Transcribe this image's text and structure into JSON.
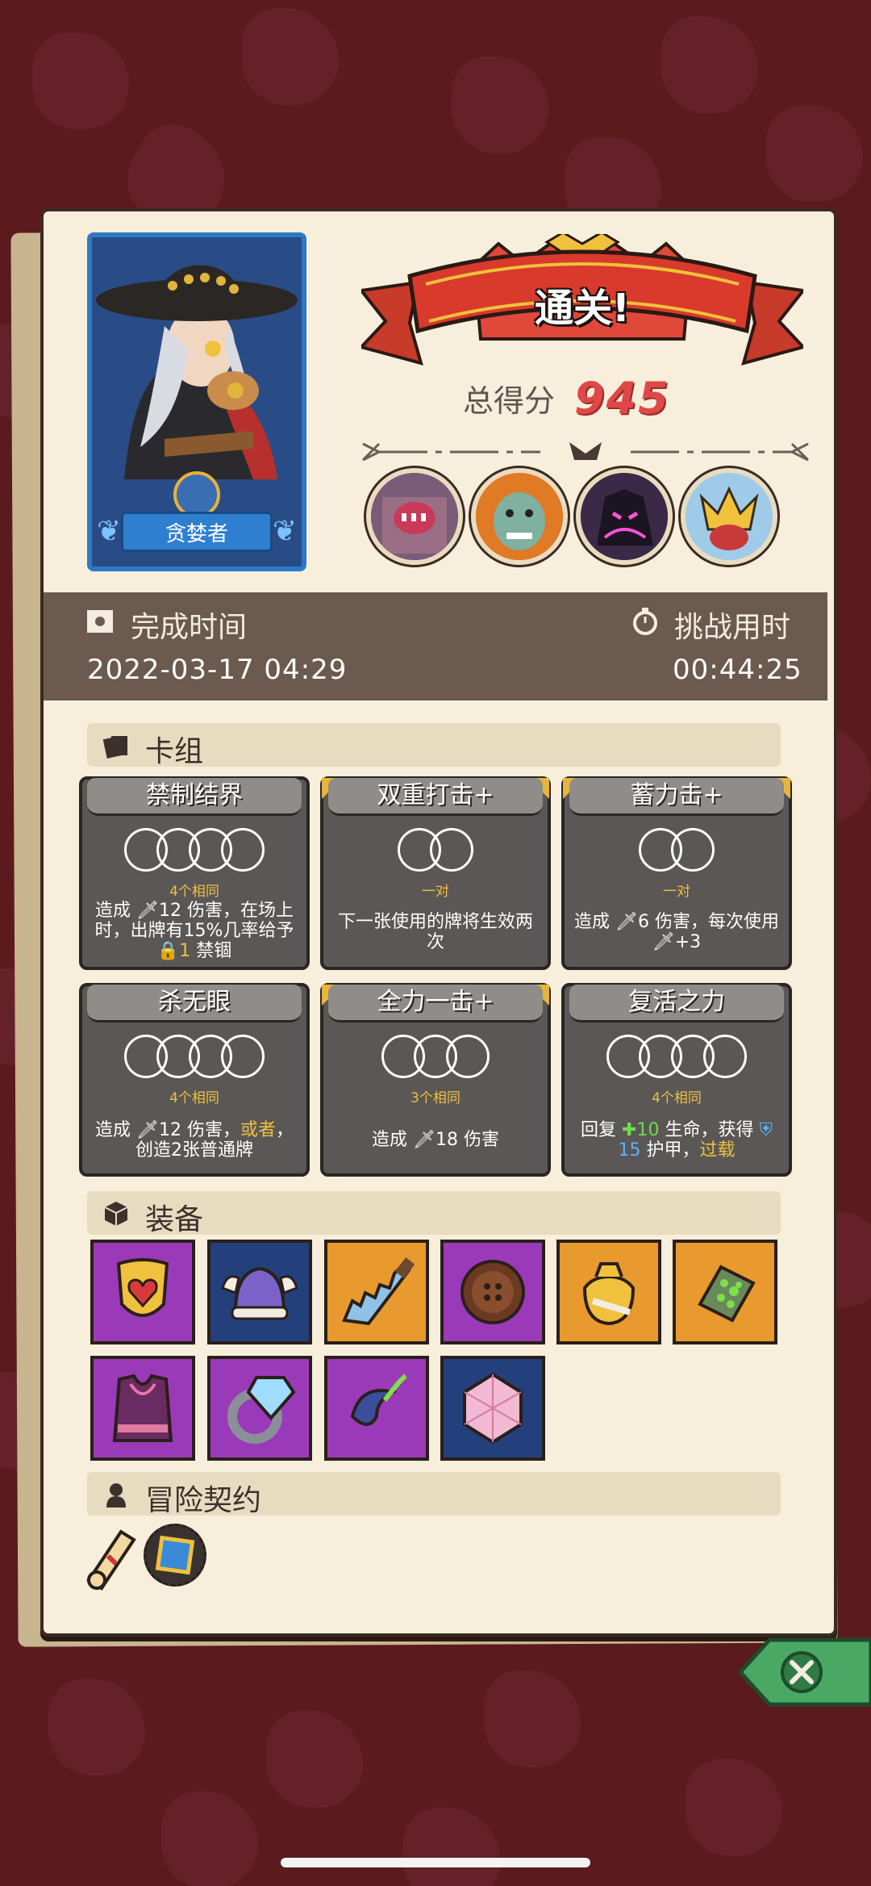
{
  "hero": {
    "name": "贪婪者"
  },
  "result": {
    "banner": "通关!",
    "score_label": "总得分",
    "score_value": "945"
  },
  "times": {
    "complete_label": "完成时间",
    "complete_value": "2022-03-17 04:29",
    "challenge_label": "挑战用时",
    "challenge_value": "00:44:25"
  },
  "sections": {
    "deck": "卡组",
    "equipment": "装备",
    "contracts": "冒险契约"
  },
  "cards": [
    {
      "title": "禁制结界",
      "match": "4个相同",
      "rings": 4,
      "desc_parts": [
        "造成 ",
        "12",
        " 伤害，在场上时，出牌有",
        "15%",
        "几率给予",
        "1",
        " 禁锢"
      ]
    },
    {
      "title": "双重打击+",
      "match": "一对",
      "rings": 2,
      "desc": "下一张使用的牌将生效两次"
    },
    {
      "title": "蓄力击+",
      "match": "一对",
      "rings": 2,
      "desc_a": "造成 ",
      "desc_b": "6",
      "desc_c": " 伤害，每次使用",
      "desc_d": "+3"
    },
    {
      "title": "杀无眼",
      "match": "4个相同",
      "rings": 4,
      "desc_a": "造成 ",
      "desc_b": "12",
      "desc_c": " 伤害，",
      "desc_d": "或者",
      "desc_e": "，",
      "desc_f": "创造2张普通牌"
    },
    {
      "title": "全力一击+",
      "match": "3个相同",
      "rings": 3,
      "desc_a": "造成 ",
      "desc_b": "18",
      "desc_c": " 伤害"
    },
    {
      "title": "复活之力",
      "match": "4个相同",
      "rings": 4,
      "desc_a": "回复 ",
      "desc_b": "10",
      "desc_c": " 生命，获得 ",
      "desc_d": "15",
      "desc_e": " 护甲，",
      "desc_f": "过载"
    }
  ],
  "equipment": [
    {
      "icon": "heart-shield-icon",
      "color": "#9b3ab8"
    },
    {
      "icon": "viking-helmet-icon",
      "color": "#24407c"
    },
    {
      "icon": "serrated-blade-icon",
      "color": "#e99a2e"
    },
    {
      "icon": "wooden-button-icon",
      "color": "#9b3ab8"
    },
    {
      "icon": "gold-sack-icon",
      "color": "#e99a2e"
    },
    {
      "icon": "moss-scroll-icon",
      "color": "#e99a2e"
    },
    {
      "icon": "purple-vest-icon",
      "color": "#9b3ab8"
    },
    {
      "icon": "diamond-ring-icon",
      "color": "#9b3ab8"
    },
    {
      "icon": "feather-plume-icon",
      "color": "#9b3ab8"
    },
    {
      "icon": "pink-gem-icon",
      "color": "#24407c"
    }
  ],
  "contracts": [
    {
      "icon": "scroll-contract-icon"
    },
    {
      "icon": "rune-cube-icon"
    }
  ]
}
